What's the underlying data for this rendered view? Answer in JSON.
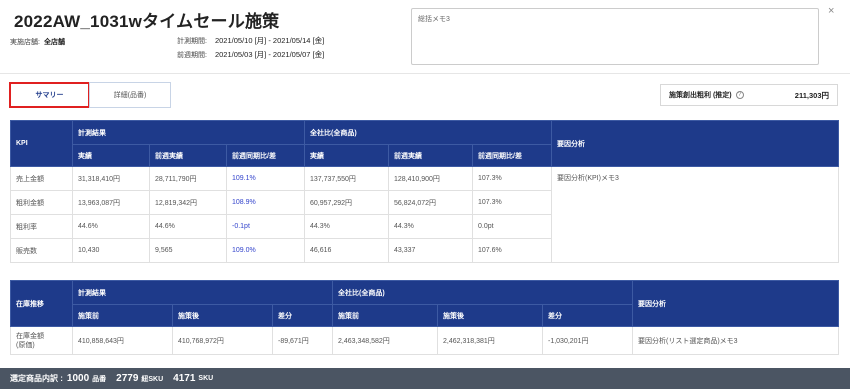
{
  "header": {
    "title": "2022AW_1031wタイムセール施策",
    "close_icon": "×",
    "store_label": "実施店舗:",
    "store_value": "全店舗",
    "measure_label": "計測期間:",
    "measure_value": "2021/05/10 [月] - 2021/05/14 [金]",
    "prev_label": "前週期間:",
    "prev_value": "2021/05/03 [月] - 2021/05/07 [金]",
    "memo": "総括メモ3"
  },
  "tabs": {
    "summary": "サマリー",
    "detail": "詳細(品番)"
  },
  "profit": {
    "label": "施策創出粗利 (推定)",
    "info_icon": "?",
    "value": "211,303円"
  },
  "kpi_table": {
    "kpi_header": "KPI",
    "group1": "計測結果",
    "group2": "全社比(全商品)",
    "analysis_header": "要因分析",
    "sub": [
      "実績",
      "前週実績",
      "前週同期比/差",
      "実績",
      "前週実績",
      "前週同期比/差"
    ],
    "rows": [
      {
        "label": "売上金額",
        "c": [
          "31,318,410円",
          "28,711,790円",
          "109.1%",
          "137,737,550円",
          "128,410,900円",
          "107.3%"
        ]
      },
      {
        "label": "粗利金額",
        "c": [
          "13,963,087円",
          "12,819,342円",
          "108.9%",
          "60,957,292円",
          "56,824,072円",
          "107.3%"
        ]
      },
      {
        "label": "粗利率",
        "c": [
          "44.6%",
          "44.6%",
          "-0.1pt",
          "44.3%",
          "44.3%",
          "0.0pt"
        ]
      },
      {
        "label": "販売数",
        "c": [
          "10,430",
          "9,565",
          "109.0%",
          "46,616",
          "43,337",
          "107.6%"
        ]
      }
    ],
    "analysis_text": "要因分析(KPI)メモ3"
  },
  "inventory_table": {
    "header": "在庫推移",
    "group1": "計測結果",
    "group2": "全社比(全商品)",
    "analysis_header": "要因分析",
    "sub": [
      "施策前",
      "施策後",
      "差分",
      "施策前",
      "施策後",
      "差分"
    ],
    "row_label_1": "在庫金額",
    "row_label_2": "(原価)",
    "row": [
      "410,858,643円",
      "410,768,972円",
      "-89,671円",
      "2,463,348,582円",
      "2,462,318,381円",
      "-1,030,201円"
    ],
    "analysis_text": "要因分析(リスト選定商品)メモ3"
  },
  "footer": {
    "label": "選定商品内訳 :",
    "count1": "1000",
    "unit1": "品番",
    "count2": "2779",
    "unit2": "紐SKU",
    "count3": "4171",
    "unit3": "SKU"
  },
  "colors": {
    "table_header": "#1e3a8a",
    "highlight_text": "#3344cc",
    "active_tab_border": "#e02020",
    "footer_bg": "#4b5563"
  }
}
